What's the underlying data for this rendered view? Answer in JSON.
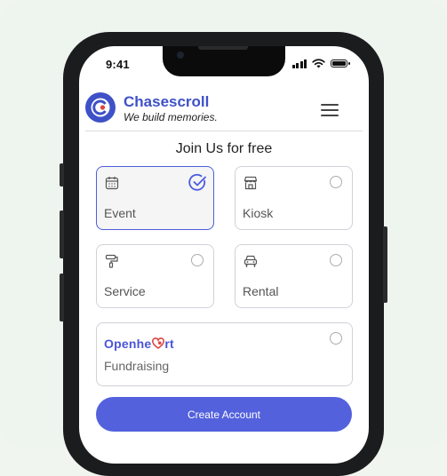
{
  "status_bar": {
    "time": "9:41"
  },
  "header": {
    "brand": "Chasescroll",
    "tagline": "We  build memories."
  },
  "heading": "Join Us for free",
  "options": [
    {
      "label": "Event",
      "icon": "calendar-icon",
      "selected": true
    },
    {
      "label": "Kiosk",
      "icon": "storefront-icon",
      "selected": false
    },
    {
      "label": "Service",
      "icon": "paint-roller-icon",
      "selected": false
    },
    {
      "label": "Rental",
      "icon": "car-icon",
      "selected": false
    }
  ],
  "fundraising": {
    "brand_prefix": "Openhe",
    "brand_suffix": "rt",
    "label": "Fundraising"
  },
  "cta": {
    "label": "Create Account"
  },
  "colors": {
    "accent": "#5361dd",
    "brand": "#3f51c7",
    "heart": "#e0433e"
  }
}
